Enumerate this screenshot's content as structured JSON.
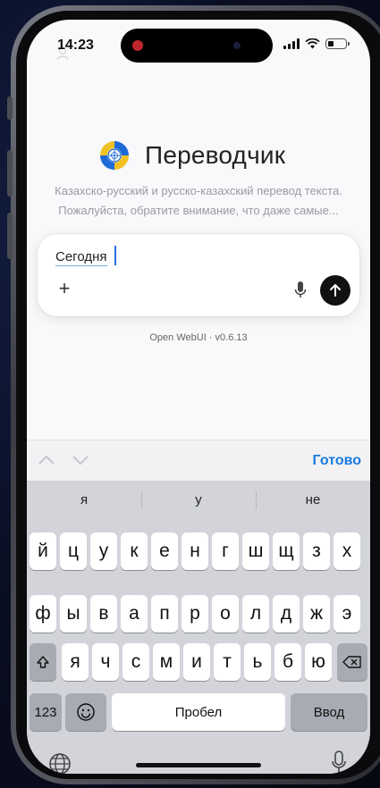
{
  "status_bar": {
    "time": "14:23"
  },
  "app": {
    "title": "Переводчик",
    "description_line1": "Казахско-русский и русско-казахский перевод текста.",
    "description_line2": "Пожалуйста, обратите внимание, что даже самые..."
  },
  "composer": {
    "input_value": "Сегодня",
    "plus_label": "+"
  },
  "footer": {
    "text": "Open WebUI · v0.6.13"
  },
  "accessory_bar": {
    "done_label": "Готово"
  },
  "keyboard": {
    "suggestions": [
      "я",
      "у",
      "не"
    ],
    "row1": [
      "й",
      "ц",
      "у",
      "к",
      "е",
      "н",
      "г",
      "ш",
      "щ",
      "з",
      "х"
    ],
    "row2": [
      "ф",
      "ы",
      "в",
      "а",
      "п",
      "р",
      "о",
      "л",
      "д",
      "ж",
      "э"
    ],
    "row3": [
      "я",
      "ч",
      "с",
      "м",
      "и",
      "т",
      "ь",
      "б",
      "ю"
    ],
    "numbers_label": "123",
    "space_label": "Пробел",
    "return_label": "Ввод"
  }
}
